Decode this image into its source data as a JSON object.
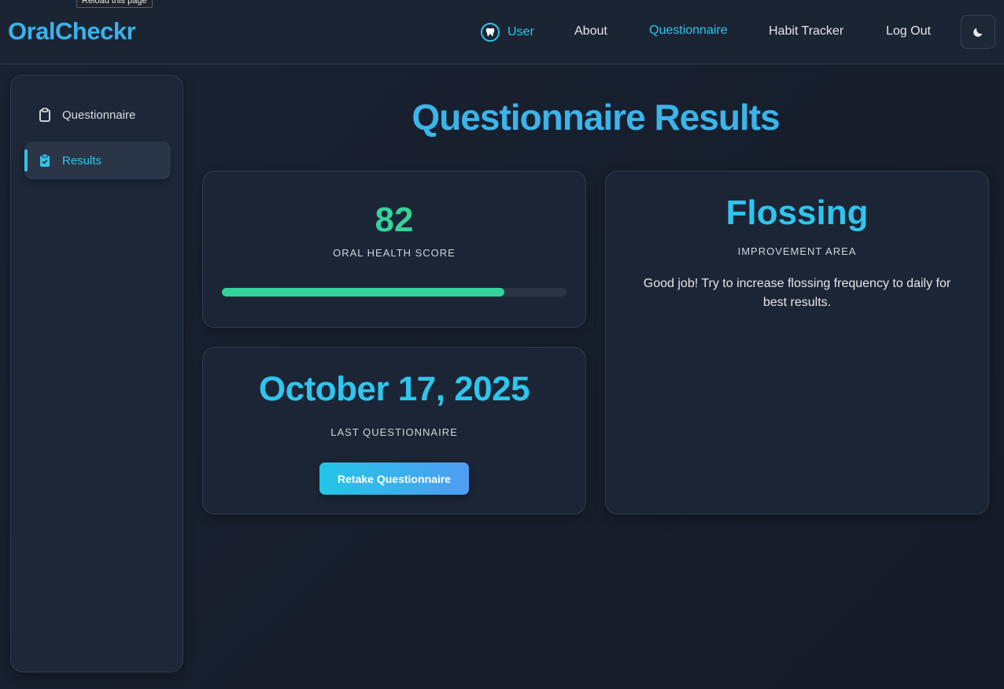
{
  "tooltip": "Reload this page",
  "header": {
    "brand": "OralCheckr",
    "user_label": "User",
    "nav": [
      "About",
      "Questionnaire",
      "Habit Tracker",
      "Log Out"
    ]
  },
  "sidebar": {
    "items": [
      {
        "label": "Questionnaire",
        "icon": "clipboard-icon"
      },
      {
        "label": "Results",
        "icon": "clipboard-check-icon"
      }
    ]
  },
  "main": {
    "title": "Questionnaire Results",
    "score": {
      "value": "82",
      "label": "ORAL HEALTH SCORE",
      "progress": 0.82
    },
    "last": {
      "date": "October 17, 2025",
      "label": "LAST QUESTIONNAIRE",
      "button": "Retake Questionnaire"
    },
    "focus": {
      "title": "Flossing",
      "label": "IMPROVEMENT AREA",
      "text": "Good job! Try to increase flossing frequency to daily for best results."
    }
  },
  "colors": {
    "accent": "#2ec5ef",
    "score": "#34d399",
    "brand": "#3bb2ea"
  }
}
